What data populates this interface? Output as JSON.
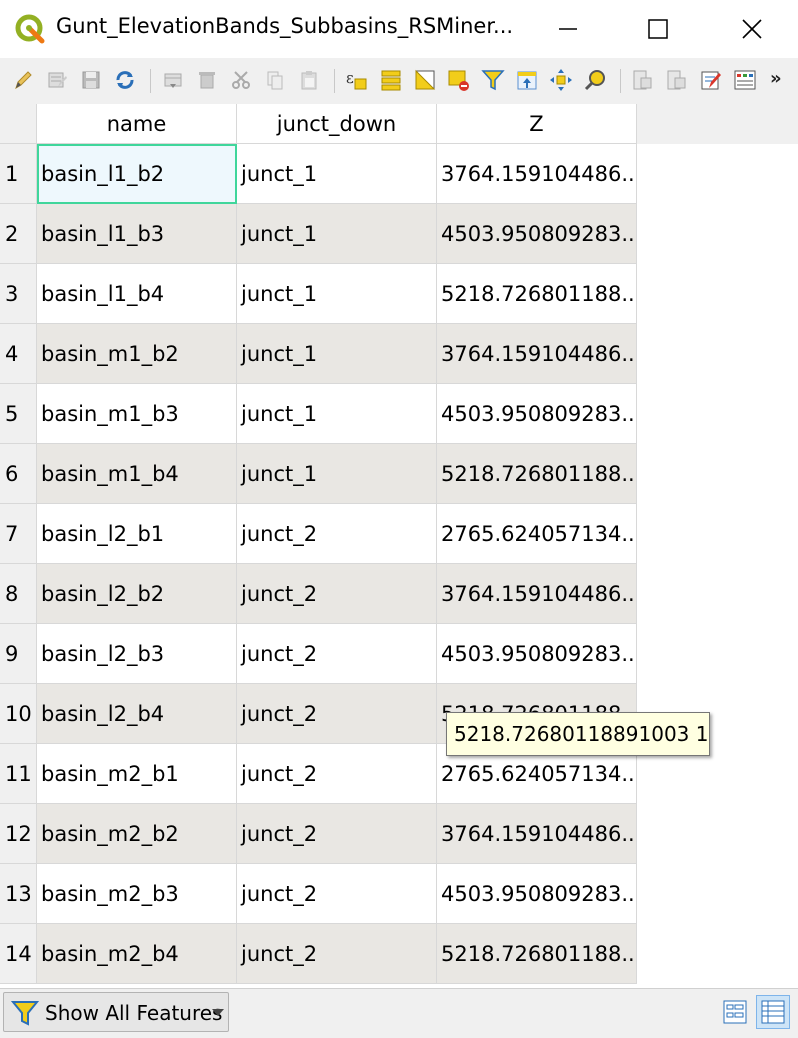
{
  "window": {
    "title": "Gunt_ElevationBands_Subbasins_RSMiner..."
  },
  "toolbar": {
    "icons": [
      "toggle-editing-icon",
      "multi-edit-icon",
      "save-edits-icon",
      "reload-icon",
      "add-feature-icon",
      "delete-feature-icon",
      "cut-icon",
      "copy-icon",
      "paste-icon",
      "select-by-expression-icon",
      "select-all-icon",
      "invert-selection-icon",
      "deselect-all-icon",
      "filter-select-icon",
      "move-selection-top-icon",
      "pan-to-selected-icon",
      "zoom-to-selected-icon",
      "new-field-icon",
      "delete-field-icon",
      "field-calculator-icon",
      "conditional-formatting-icon"
    ],
    "more": "»"
  },
  "table": {
    "columns": [
      "name",
      "junct_down",
      "Z"
    ],
    "rows": [
      {
        "num": "1",
        "name": "basin_l1_b2",
        "junct": "junct_1",
        "z": "3764.159104486..."
      },
      {
        "num": "2",
        "name": "basin_l1_b3",
        "junct": "junct_1",
        "z": "4503.950809283..."
      },
      {
        "num": "3",
        "name": "basin_l1_b4",
        "junct": "junct_1",
        "z": "5218.726801188..."
      },
      {
        "num": "4",
        "name": "basin_m1_b2",
        "junct": "junct_1",
        "z": "3764.159104486..."
      },
      {
        "num": "5",
        "name": "basin_m1_b3",
        "junct": "junct_1",
        "z": "4503.950809283..."
      },
      {
        "num": "6",
        "name": "basin_m1_b4",
        "junct": "junct_1",
        "z": "5218.726801188..."
      },
      {
        "num": "7",
        "name": "basin_l2_b1",
        "junct": "junct_2",
        "z": "2765.624057134..."
      },
      {
        "num": "8",
        "name": "basin_l2_b2",
        "junct": "junct_2",
        "z": "3764.159104486..."
      },
      {
        "num": "9",
        "name": "basin_l2_b3",
        "junct": "junct_2",
        "z": "4503.950809283..."
      },
      {
        "num": "10",
        "name": "basin_l2_b4",
        "junct": "junct_2",
        "z": "5218.726801188..."
      },
      {
        "num": "11",
        "name": "basin_m2_b1",
        "junct": "junct_2",
        "z": "2765.624057134..."
      },
      {
        "num": "12",
        "name": "basin_m2_b2",
        "junct": "junct_2",
        "z": "3764.159104486..."
      },
      {
        "num": "13",
        "name": "basin_m2_b3",
        "junct": "junct_2",
        "z": "4503.950809283..."
      },
      {
        "num": "14",
        "name": "basin_m2_b4",
        "junct": "junct_2",
        "z": "5218.726801188..."
      }
    ],
    "tooltip": "5218.72680118891003 1"
  },
  "bottom": {
    "filter_label": "Show All Features"
  },
  "colors": {
    "selection_border": "#3fd69b",
    "alt_row": "#e9e7e3",
    "tooltip_bg": "#ffffe1",
    "active_view": "#cde4f7"
  }
}
